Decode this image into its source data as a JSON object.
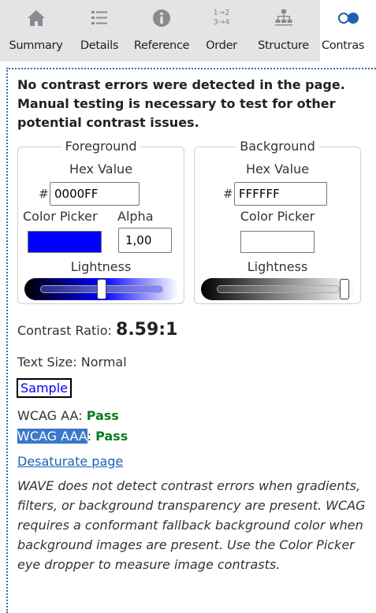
{
  "tabs": [
    {
      "label": "Summary",
      "icon": "home-icon"
    },
    {
      "label": "Details",
      "icon": "list-icon"
    },
    {
      "label": "Reference",
      "icon": "info-icon"
    },
    {
      "label": "Order",
      "icon": "order-icon",
      "glyph_top": "1→2",
      "glyph_bottom": "3→4"
    },
    {
      "label": "Structure",
      "icon": "structure-icon"
    },
    {
      "label": "Contras",
      "icon": "contrast-icon",
      "active": true
    }
  ],
  "message": "No contrast errors were detected in the page. Manual testing is necessary to test for other potential contrast issues.",
  "foreground": {
    "title": "Foreground",
    "hex_label": "Hex Value",
    "hash": "#",
    "hex_value": "0000FF",
    "picker_label": "Color Picker",
    "alpha_label": "Alpha",
    "alpha_value": "1,00",
    "lightness_label": "Lightness",
    "swatch_color": "#0000ff",
    "lightness": 0.5
  },
  "background": {
    "title": "Background",
    "hex_label": "Hex Value",
    "hash": "#",
    "hex_value": "FFFFFF",
    "picker_label": "Color Picker",
    "lightness_label": "Lightness",
    "swatch_color": "#ffffff",
    "lightness": 1.0
  },
  "contrast": {
    "label": "Contrast Ratio: ",
    "value": "8.59:1"
  },
  "text_size": "Text Size: Normal",
  "sample": "Sample",
  "wcag_aa": {
    "label": "WCAG AA",
    "sep": ": ",
    "result": "Pass"
  },
  "wcag_aaa": {
    "label": "WCAG AAA",
    "sep": ": ",
    "result": "Pass"
  },
  "desaturate": "Desaturate page",
  "note": "WAVE does not detect contrast errors when gradients, filters, or background transparency are present. WCAG requires a conformant fallback background color when background images are present. Use the Color Picker eye dropper to measure image contrasts.",
  "colors": {
    "tab_bar": "#e4e4e6",
    "pass": "#0a7d1e",
    "link": "#1a5fb4",
    "highlight": "#3a78c9"
  }
}
